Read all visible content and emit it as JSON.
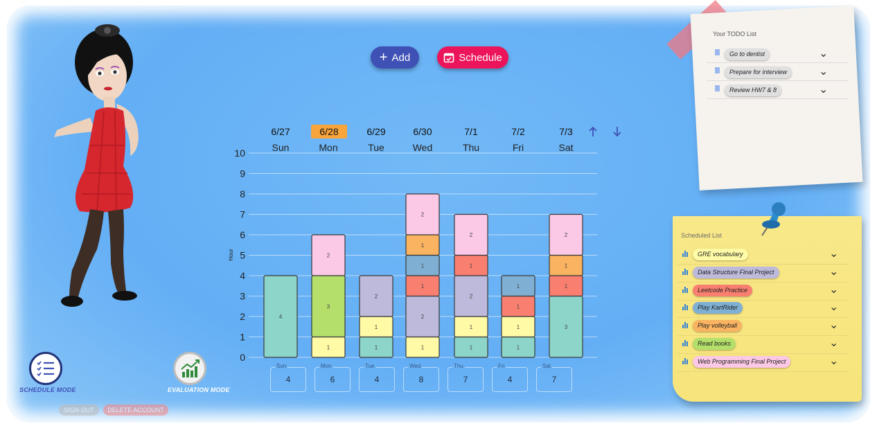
{
  "buttons": {
    "add_label": "Add",
    "schedule_label": "Schedule"
  },
  "week": [
    {
      "date": "6/27",
      "day": "Sun",
      "today": false
    },
    {
      "date": "6/28",
      "day": "Mon",
      "today": true
    },
    {
      "date": "6/29",
      "day": "Tue",
      "today": false
    },
    {
      "date": "6/30",
      "day": "Wed",
      "today": false
    },
    {
      "date": "7/1",
      "day": "Thu",
      "today": false
    },
    {
      "date": "7/2",
      "day": "Fri",
      "today": false
    },
    {
      "date": "7/3",
      "day": "Sat",
      "today": false
    }
  ],
  "nav_icons": {
    "up": "arrow-up-icon",
    "down": "arrow-down-icon"
  },
  "chart_data": {
    "type": "bar",
    "stacked": true,
    "ylabel": "Hour",
    "ylim": [
      0,
      10
    ],
    "yticks": [
      0,
      1,
      2,
      3,
      4,
      5,
      6,
      7,
      8,
      9,
      10
    ],
    "categories": [
      "Sun",
      "Mon",
      "Tue",
      "Wed",
      "Thu",
      "Fri",
      "Sat"
    ],
    "stacks": [
      [
        {
          "v": 4,
          "c": "#8dd5c8"
        }
      ],
      [
        {
          "v": 1,
          "c": "#fffaa6"
        },
        {
          "v": 3,
          "c": "#b4df6a"
        },
        {
          "v": 2,
          "c": "#fbc8e6"
        }
      ],
      [
        {
          "v": 1,
          "c": "#8dd5c8"
        },
        {
          "v": 1,
          "c": "#fffaa6"
        },
        {
          "v": 2,
          "c": "#bebadb"
        }
      ],
      [
        {
          "v": 1,
          "c": "#fffaa6"
        },
        {
          "v": 2,
          "c": "#bebadb"
        },
        {
          "v": 1,
          "c": "#f97f71"
        },
        {
          "v": 1,
          "c": "#7fb0d3"
        },
        {
          "v": 1,
          "c": "#f9b361"
        },
        {
          "v": 2,
          "c": "#fbc8e6"
        }
      ],
      [
        {
          "v": 1,
          "c": "#8dd5c8"
        },
        {
          "v": 1,
          "c": "#fffaa6"
        },
        {
          "v": 2,
          "c": "#bebadb"
        },
        {
          "v": 1,
          "c": "#f97f71"
        },
        {
          "v": 2,
          "c": "#fbc8e6"
        }
      ],
      [
        {
          "v": 1,
          "c": "#8dd5c8"
        },
        {
          "v": 1,
          "c": "#fffaa6"
        },
        {
          "v": 1,
          "c": "#f97f71"
        },
        {
          "v": 1,
          "c": "#7fb0d3"
        }
      ],
      [
        {
          "v": 3,
          "c": "#8dd5c8"
        },
        {
          "v": 1,
          "c": "#f97f71"
        },
        {
          "v": 1,
          "c": "#f9b361"
        },
        {
          "v": 2,
          "c": "#fbc8e6"
        }
      ]
    ]
  },
  "totals": [
    {
      "day": "Sun",
      "value": "4"
    },
    {
      "day": "Mon",
      "value": "6"
    },
    {
      "day": "Tue",
      "value": "4"
    },
    {
      "day": "Wed",
      "value": "8"
    },
    {
      "day": "Thu",
      "value": "7"
    },
    {
      "day": "Fri",
      "value": "4"
    },
    {
      "day": "Sat",
      "value": "7"
    }
  ],
  "modes": {
    "schedule_label": "SCHEDULE MODE",
    "evaluation_label": "EVALUATION MODE"
  },
  "account": {
    "sign_out": "SIGN OUT",
    "delete": "DELETE ACCOUNT"
  },
  "todo": {
    "title": "Your TODO List",
    "items": [
      "Go to dentist",
      "Prepare for interview",
      "Review HW7 & 8"
    ]
  },
  "scheduled": {
    "title": "Scheduled List",
    "items": [
      {
        "label": "GRE vocabulary",
        "color": "#fffaa6"
      },
      {
        "label": "Data Structure Final Project",
        "color": "#bebadb"
      },
      {
        "label": "Leetcode Practice",
        "color": "#f97f71"
      },
      {
        "label": "Play KartRider",
        "color": "#7fb0d3"
      },
      {
        "label": "Play volleyball",
        "color": "#f9b361"
      },
      {
        "label": "Read books",
        "color": "#b4df6a"
      },
      {
        "label": "Web Programming Final Project",
        "color": "#fbc8e6"
      }
    ]
  },
  "colors": {
    "add": "#3f51b5",
    "schedule": "#ec145a",
    "today_highlight": "#f8a53c"
  }
}
